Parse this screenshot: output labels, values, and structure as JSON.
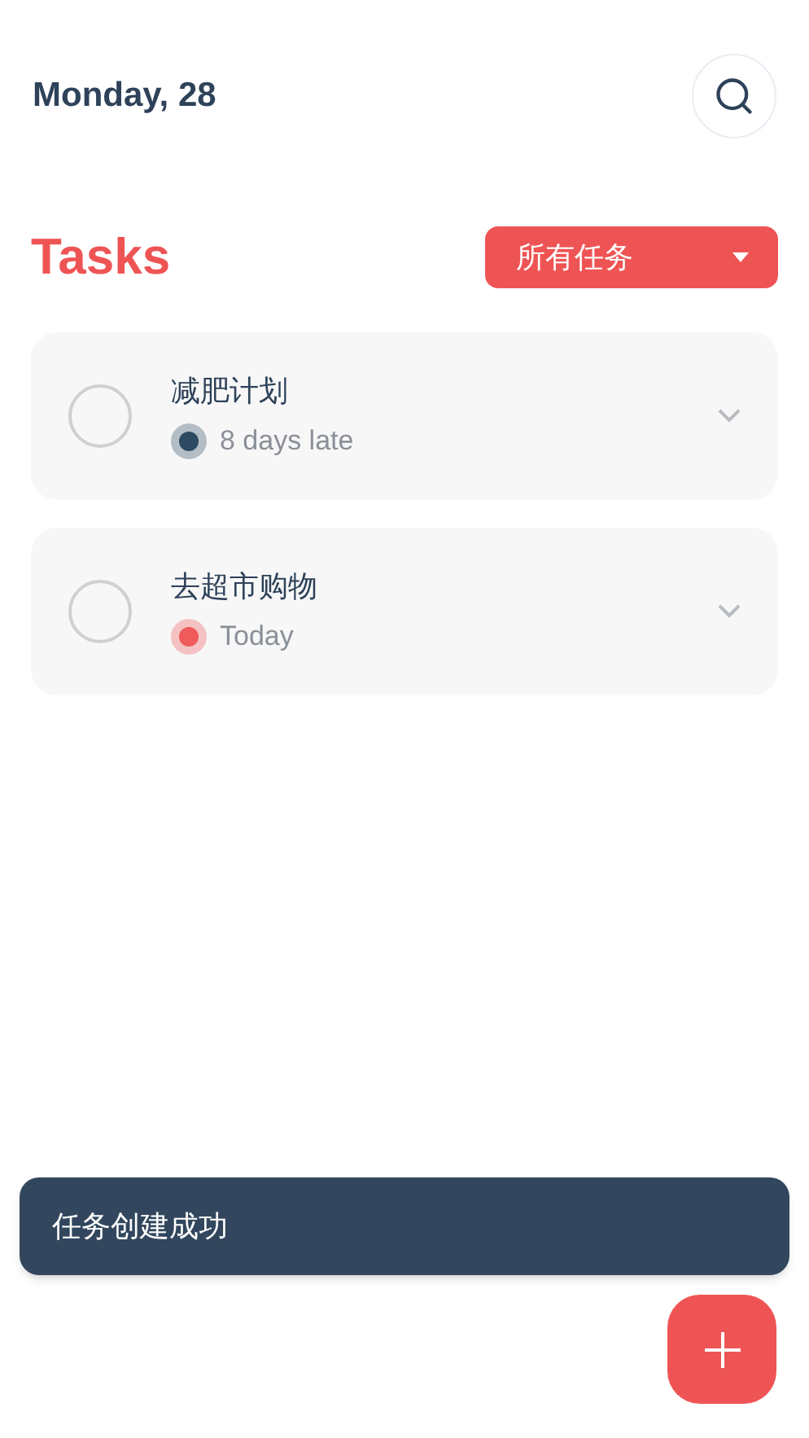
{
  "header": {
    "date": "Monday, 28"
  },
  "section": {
    "title": "Tasks",
    "filter": "所有任务"
  },
  "tasks": [
    {
      "title": "减肥计划",
      "due": "8 days late",
      "color": "#2e4a62",
      "checked": false
    },
    {
      "title": "去超市购物",
      "due": "Today",
      "color": "#ef5b5b",
      "checked": false
    }
  ],
  "toast": {
    "message": "任务创建成功"
  }
}
